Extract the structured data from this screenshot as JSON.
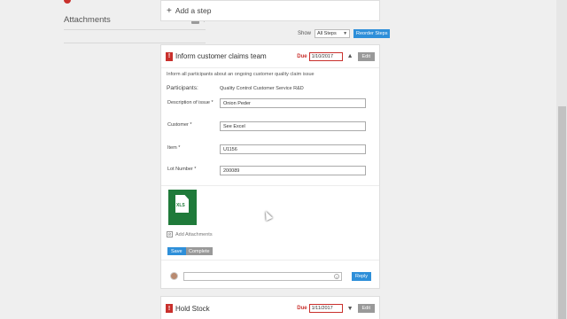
{
  "sidebar": {
    "attachments_label": "Attachments",
    "attachments_count": "1"
  },
  "add_step": {
    "label": "Add a step"
  },
  "toolbar": {
    "show_label": "Show",
    "filter_value": "All Steps",
    "reorder_label": "Reorder Steps"
  },
  "step1": {
    "title": "Inform customer claims team",
    "due_label": "Due",
    "due_date": "1/10/2017",
    "edit_label": "Edit",
    "description": "Inform all participants about an ongoing customer quality claim issue",
    "participants_label": "Participants:",
    "participants_value": "Quality Control Customer Service R&D",
    "fields": [
      {
        "label": "Description of issue *",
        "value": "Onion Peder"
      },
      {
        "label": "Customer *",
        "value": "See Excel"
      },
      {
        "label": "Item *",
        "value": "U1156"
      },
      {
        "label": "Lot Number *",
        "value": "200089"
      }
    ],
    "file_type": "XLS",
    "add_attachments_label": "Add Attachments",
    "save_label": "Save",
    "complete_label": "Complete",
    "reply_label": "Reply"
  },
  "step2": {
    "title": "Hold Stock",
    "due_label": "Due",
    "due_date": "1/11/2017",
    "edit_label": "Edit"
  },
  "colors": {
    "accent": "#2e8fd9",
    "alert": "#c9302c",
    "excel": "#1f7a3a"
  }
}
